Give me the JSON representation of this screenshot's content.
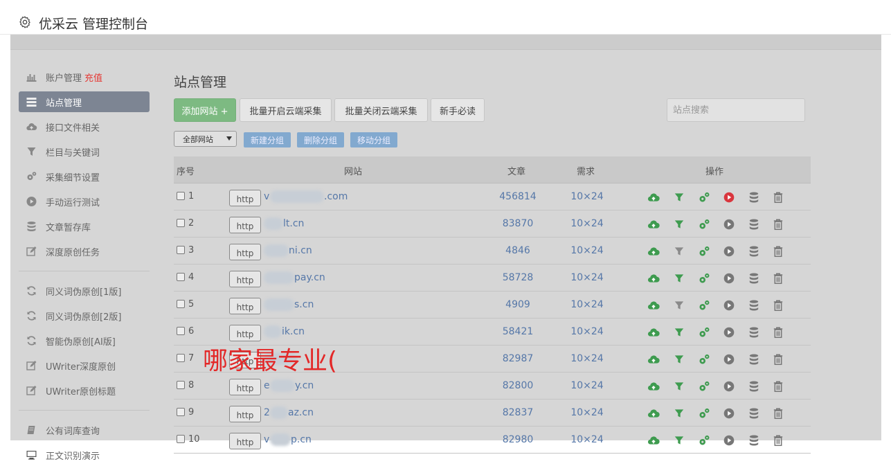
{
  "header": {
    "title": "优采云 管理控制台",
    "icon": "gear-icon"
  },
  "sidebar": {
    "items": [
      {
        "label": "账户管理",
        "extra": "充值",
        "icon": "bar-chart-icon"
      },
      {
        "label": "站点管理",
        "icon": "list-icon",
        "active": true
      },
      {
        "label": "接口文件相关",
        "icon": "cloud-upload-icon"
      },
      {
        "label": "栏目与关键词",
        "icon": "filter-icon"
      },
      {
        "label": "采集细节设置",
        "icon": "cogs-icon"
      },
      {
        "label": "手动运行测试",
        "icon": "play-circle-icon"
      },
      {
        "label": "文章暂存库",
        "icon": "database-icon"
      },
      {
        "label": "深度原创任务",
        "icon": "edit-icon"
      },
      {
        "label": "同义词伪原创[1版]",
        "icon": "refresh-icon"
      },
      {
        "label": "同义词伪原创[2版]",
        "icon": "refresh-icon"
      },
      {
        "label": "智能伪原创[AI版]",
        "icon": "refresh-icon"
      },
      {
        "label": "UWriter深度原创",
        "icon": "edit-icon"
      },
      {
        "label": "UWriter原创标题",
        "icon": "edit-icon"
      },
      {
        "label": "公有词库查询",
        "icon": "book-icon"
      },
      {
        "label": "正文识别演示",
        "icon": "monitor-icon"
      }
    ]
  },
  "main": {
    "title": "站点管理",
    "toolbar": {
      "add_site": "添加网站 +",
      "batch_enable": "批量开启云端采集",
      "batch_disable": "批量关闭云端采集",
      "guide": "新手必读"
    },
    "search": {
      "placeholder": "站点搜索"
    },
    "group_filter": {
      "selected": "全部网站"
    },
    "group_actions": {
      "new_group": "新建分组",
      "delete_group": "删除分组",
      "move_group": "移动分组"
    },
    "table": {
      "headers": {
        "index": "序号",
        "site": "网站",
        "articles": "文章",
        "demand": "需求",
        "actions": "操作"
      },
      "rows": [
        {
          "index": "1",
          "protocol": "http",
          "site_prefix": "v",
          "site_suffix": ".com",
          "articles": "456814",
          "demand": "10×24",
          "run_active": true
        },
        {
          "index": "2",
          "protocol": "http",
          "site_prefix": "",
          "site_suffix": "lt.cn",
          "articles": "83870",
          "demand": "10×24",
          "run_active": false
        },
        {
          "index": "3",
          "protocol": "http",
          "site_prefix": "",
          "site_suffix": "ni.cn",
          "articles": "4846",
          "demand": "10×24",
          "run_active": false
        },
        {
          "index": "4",
          "protocol": "http",
          "site_prefix": "",
          "site_suffix": "pay.cn",
          "articles": "58728",
          "demand": "10×24",
          "run_active": false
        },
        {
          "index": "5",
          "protocol": "http",
          "site_prefix": "",
          "site_suffix": "s.cn",
          "articles": "4909",
          "demand": "10×24",
          "run_active": false
        },
        {
          "index": "6",
          "protocol": "http",
          "site_prefix": "",
          "site_suffix": "ik.cn",
          "articles": "58421",
          "demand": "10×24",
          "run_active": false
        },
        {
          "index": "7",
          "protocol": "http",
          "site_prefix": "",
          "site_suffix": "",
          "articles": "82987",
          "demand": "10×24",
          "run_active": false
        },
        {
          "index": "8",
          "protocol": "http",
          "site_prefix": "e",
          "site_suffix": "y.cn",
          "articles": "82800",
          "demand": "10×24",
          "run_active": false
        },
        {
          "index": "9",
          "protocol": "http",
          "site_prefix": "2",
          "site_suffix": "az.cn",
          "articles": "82837",
          "demand": "10×24",
          "run_active": false
        },
        {
          "index": "10",
          "protocol": "http",
          "site_prefix": "v",
          "site_suffix": "p.cn",
          "articles": "82980",
          "demand": "10×24",
          "run_active": false
        }
      ]
    }
  },
  "overlay": {
    "text": "哪家最专业("
  },
  "colors": {
    "accent_green": "#7dba82",
    "link_blue": "#5577a8",
    "active_red": "#e53935",
    "sidebar_active": "#7d8593",
    "group_button": "#82a9cf"
  }
}
